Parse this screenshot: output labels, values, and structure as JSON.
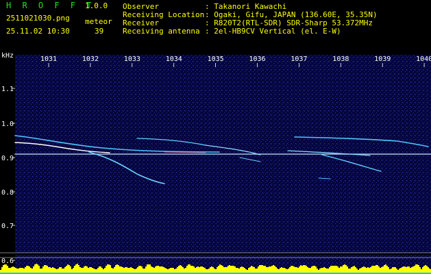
{
  "header": {
    "app_title": "H R O F F T",
    "version": "1.0.0",
    "filename": "2511021030.png",
    "datetime": "25.11.02 10:30",
    "meteor_label": "meteor",
    "meteor_count": "39"
  },
  "info": [
    {
      "label": "Observer",
      "value": ": Takanori Kawachi"
    },
    {
      "label": "Receiving Location",
      "value": ": Ogaki, Gifu, JAPAN (136.60E, 35.35N)"
    },
    {
      "label": "Receiver",
      "value": ": R820T2(RTL-SDR) SDR-Sharp 53.372MHz"
    },
    {
      "label": "Receiving antenna",
      "value": ": 2el-HB9CV Vertical (el. E-W)"
    }
  ],
  "axes": {
    "y_unit": "kHz",
    "y_ticks": [
      "1.1",
      "1.0",
      "0.9",
      "0.8",
      "0.7",
      "0.6"
    ],
    "x_ticks": [
      "1031",
      "1032",
      "1033",
      "1034",
      "1035",
      "1036",
      "1037",
      "1038",
      "1039",
      "1040"
    ]
  },
  "colors": {
    "background": "#000000",
    "noise": "#0a0a5a",
    "text_main": "#ffff00",
    "title": "#17e817",
    "echo": "#60d0ff",
    "carrier": "#c8e8ff",
    "bar": "#ffff00",
    "bar_base": "#00c8ff"
  }
}
